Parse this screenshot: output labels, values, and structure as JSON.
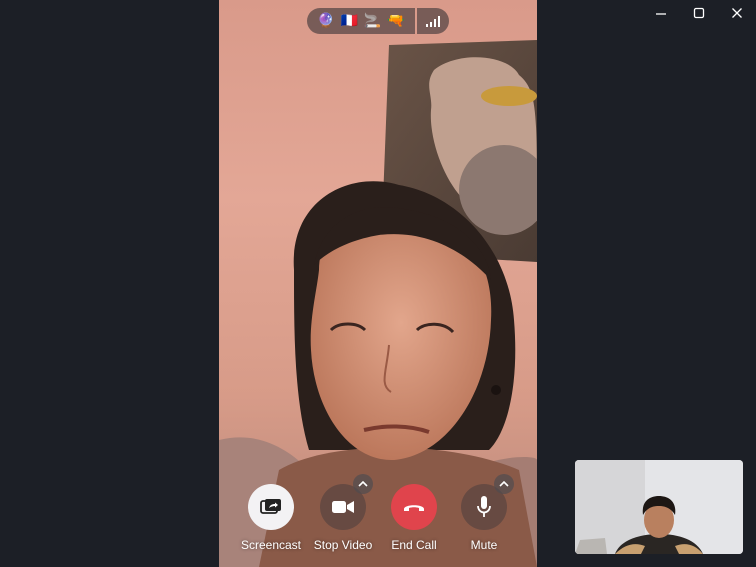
{
  "window": {
    "controls": [
      {
        "name": "minimize-icon"
      },
      {
        "name": "maximize-icon"
      },
      {
        "name": "close-icon"
      }
    ]
  },
  "top_bar": {
    "emojis": [
      {
        "name": "crystal-ball-icon",
        "glyph": "🔮"
      },
      {
        "name": "france-flag-icon",
        "glyph": "🇫🇷"
      },
      {
        "name": "cigarette-icon",
        "glyph": "🚬"
      },
      {
        "name": "water-pistol-icon",
        "glyph": "🔫"
      }
    ],
    "signal_icon": "signal-bars-icon"
  },
  "controls": {
    "screencast_label": "Screencast",
    "stop_video_label": "Stop Video",
    "end_call_label": "End Call",
    "mute_label": "Mute"
  },
  "colors": {
    "background": "#1c1f26",
    "end_call": "#e0444c",
    "screencast_button": "#f3f2f4"
  }
}
